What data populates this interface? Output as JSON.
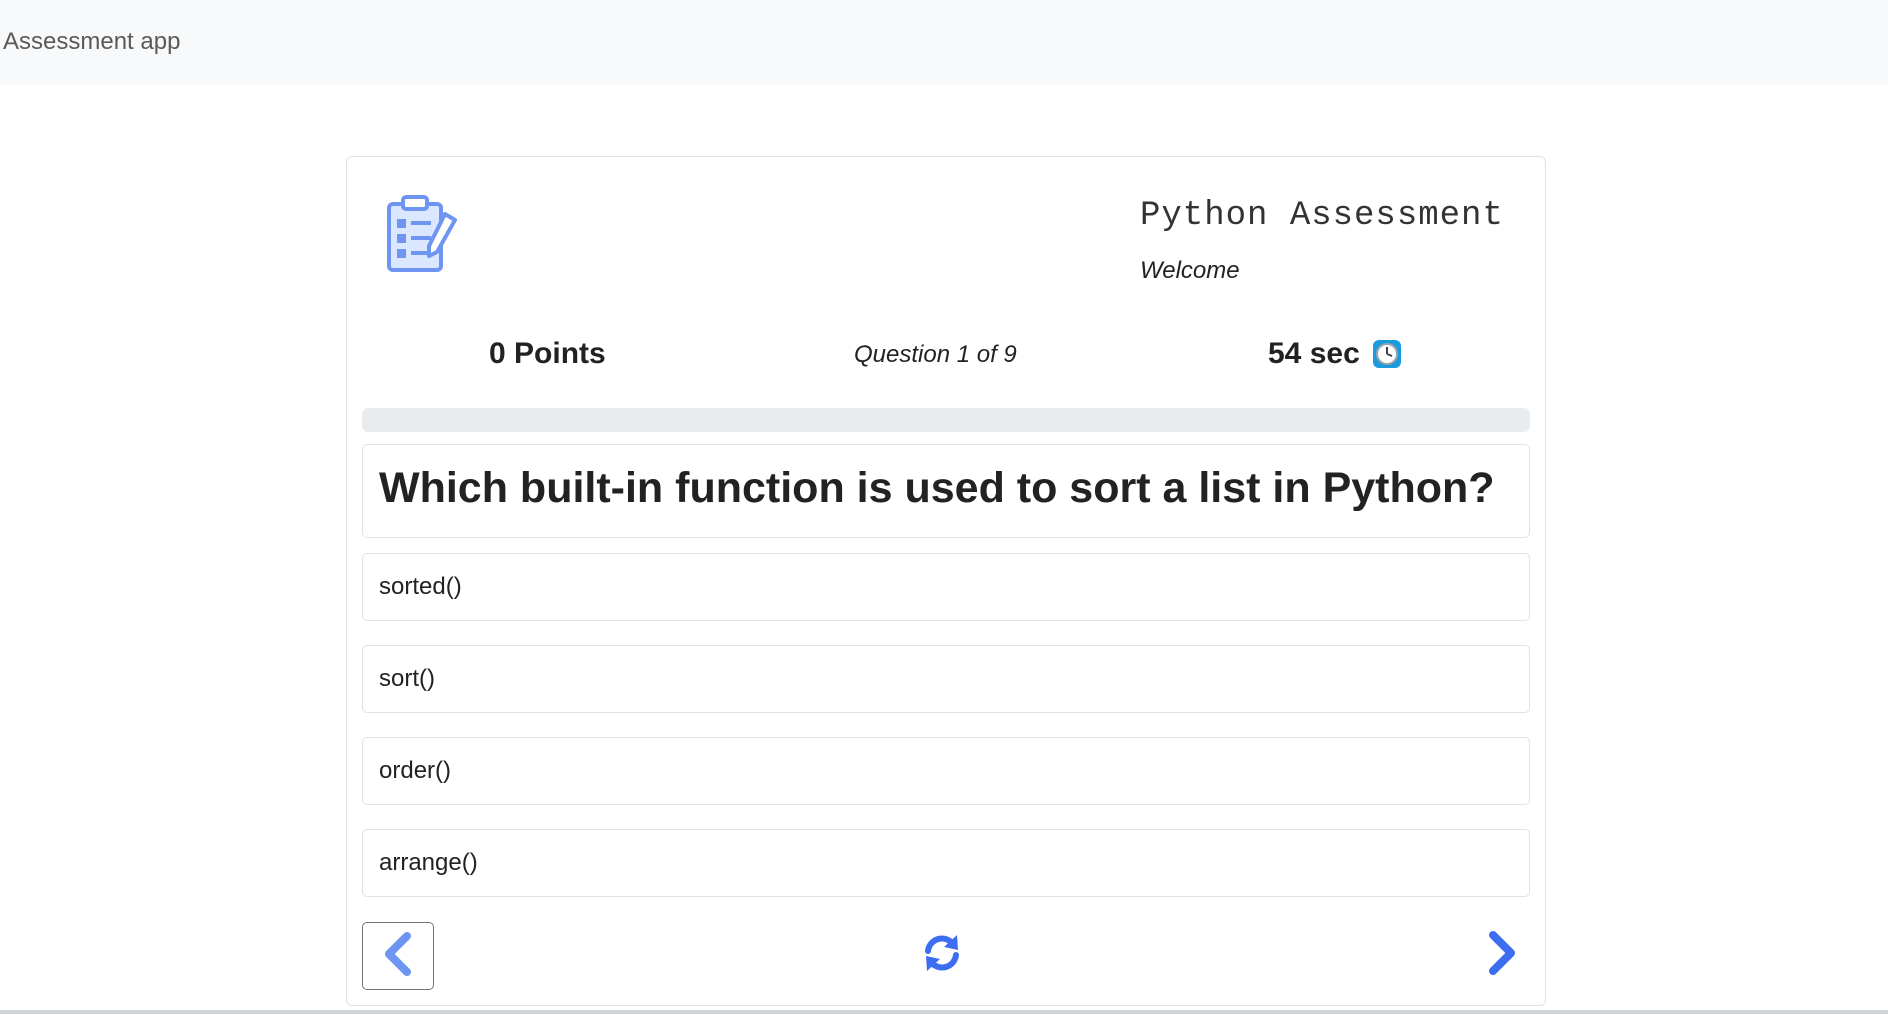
{
  "navbar": {
    "brand": "Assessment app"
  },
  "header": {
    "title": "Python Assessment",
    "subtitle": "Welcome",
    "logo_icon": "clipboard-checklist-icon"
  },
  "stats": {
    "points": "0 Points",
    "question_counter": "Question 1 of 9",
    "timer": "54 sec",
    "timer_icon": "clock-icon"
  },
  "progress": {
    "fraction": 0.0
  },
  "question": {
    "text": "Which built-in function is used to sort a list in Python?"
  },
  "options": [
    {
      "label": "sorted()"
    },
    {
      "label": "sort()"
    },
    {
      "label": "order()"
    },
    {
      "label": "arrange()"
    }
  ],
  "controls": {
    "prev_icon": "chevron-left-icon",
    "reset_icon": "refresh-icon",
    "next_icon": "chevron-right-icon"
  },
  "colors": {
    "accent": "#3d6ef0",
    "accent_light": "#6f95f3",
    "navbar_bg": "#f8f9fa",
    "border": "#dee2e6"
  }
}
